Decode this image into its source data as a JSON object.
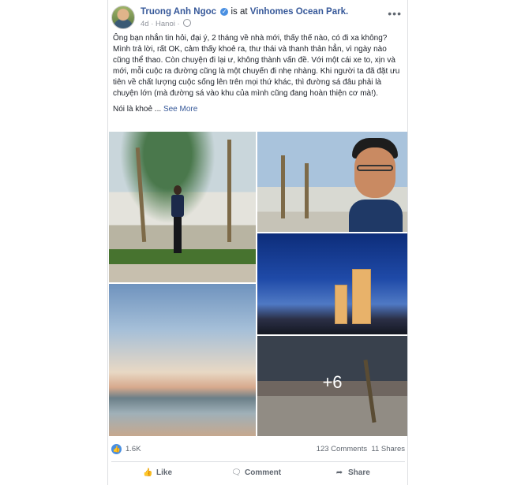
{
  "post": {
    "author": "Truong Anh Ngoc",
    "verified_icon": "verified-badge-icon",
    "connector": "is at",
    "place": "Vinhomes Ocean Park.",
    "time": "4d",
    "location": "Hanoi",
    "text": "Ông bạn nhắn tin hỏi, đại ý, 2 tháng về nhà mới, thấy thế nào, có đi xa không? Mình trả lời, rất OK, cảm thấy khoẻ ra, thư thái và thanh thản hẳn, vì ngày nào cũng thể thao. Còn chuyện đi lại ư, không thành vấn đề. Với một cái xe to, xịn và mới, mỗi cuộc ra đường cũng là một chuyến đi nhẹ nhàng. Khi người ta đã đặt ưu tiên về chất lượng cuộc sống lên trên mọi thứ khác, thì đường sá đâu phải là chuyện lớn (mà đường sá vào khu của mình cũng đang hoàn thiện cơ mà!).",
    "text_tail": "Nói là khoẻ ...",
    "see_more": "See More",
    "extra_photos": "+6"
  },
  "stats": {
    "likes": "1.6K",
    "comments": "123 Comments",
    "shares": "11 Shares"
  },
  "actions": {
    "like": "Like",
    "comment": "Comment",
    "share": "Share"
  },
  "colors": {
    "link": "#365899",
    "accent": "#4a90e2",
    "muted": "#606770"
  }
}
